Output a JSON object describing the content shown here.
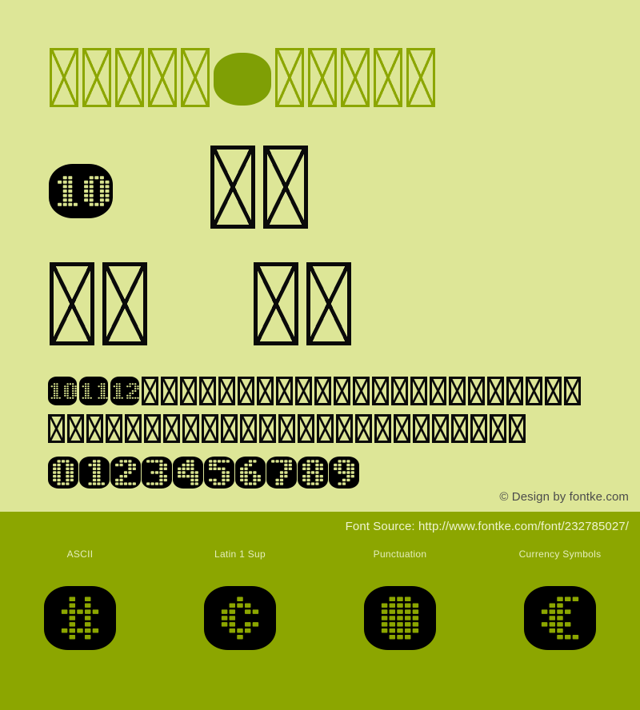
{
  "page": {
    "background_color": "#dde697",
    "band_color": "#8ca600",
    "title_outline_color": "#8ca600",
    "ink_color": "#0a0a0a",
    "led_color": "#8ca600",
    "led_highlight_color": "#d9e38f"
  },
  "title": {
    "name": "font-preview-title",
    "glyph_count_before_space": 5,
    "glyph_count_after_space": 5,
    "space_tile": "solid-rounded-tile"
  },
  "specimen": {
    "big_rows": [
      {
        "groups": [
          1,
          2
        ]
      },
      {
        "groups": [
          2,
          2
        ]
      }
    ],
    "feature_tile_label": "10"
  },
  "sample_text": {
    "tiles": [
      "10",
      "11",
      "12"
    ],
    "row1_notdef_count": 23,
    "row2_notdef_count": 25
  },
  "digits": {
    "values": [
      "0",
      "1",
      "2",
      "3",
      "4",
      "5",
      "6",
      "7",
      "8",
      "9"
    ]
  },
  "footer": {
    "copyright": "© Design by fontke.com",
    "font_source": "Font Source: http://www.fontke.com/font/232785027/"
  },
  "blocks": [
    {
      "label": "ASCII",
      "glyph": "#"
    },
    {
      "label": "Latin 1 Sup",
      "glyph": "¢"
    },
    {
      "label": "Punctuation",
      "glyph": "■"
    },
    {
      "label": "Currency Symbols",
      "glyph": "€"
    }
  ]
}
